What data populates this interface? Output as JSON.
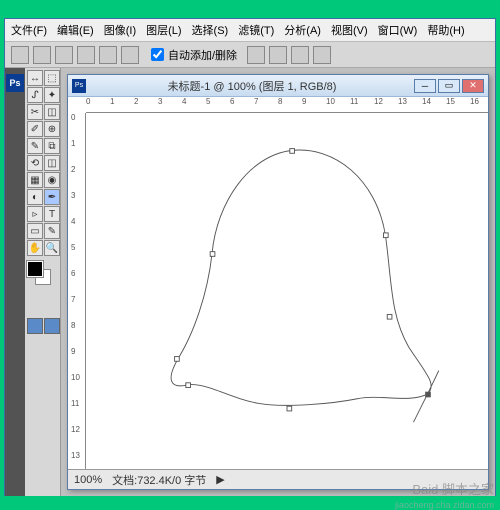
{
  "menubar": {
    "file": "文件(F)",
    "edit": "编辑(E)",
    "image": "图像(I)",
    "layer": "图层(L)",
    "select": "选择(S)",
    "filter": "滤镜(T)",
    "analysis": "分析(A)",
    "view": "视图(V)",
    "window": "窗口(W)",
    "help": "帮助(H)"
  },
  "toolbar": {
    "auto_add_delete": "自动添加/删除"
  },
  "app_badge": "Ps",
  "tools": {
    "move": "↔",
    "marquee": "⬚",
    "lasso": "ᔑ",
    "wand": "✦",
    "crop": "✂",
    "slice": "◫",
    "eyedrop": "✐",
    "heal": "⊕",
    "brush": "✎",
    "stamp": "⧉",
    "history": "⟲",
    "eraser": "◫",
    "gradient": "▦",
    "blur": "◉",
    "dodge": "◐",
    "pen": "✒",
    "type": "T",
    "path": "▹",
    "shape": "▭",
    "notes": "✎",
    "hand": "✋",
    "zoom": "🔍"
  },
  "doc": {
    "icon": "Ps",
    "title": "未标题-1 @ 100% (图层 1, RGB/8)",
    "ruler_h": [
      "0",
      "1",
      "2",
      "3",
      "4",
      "5",
      "6",
      "7",
      "8",
      "9",
      "10",
      "11",
      "12",
      "13",
      "14",
      "15",
      "16"
    ],
    "ruler_v": [
      "0",
      "1",
      "2",
      "3",
      "4",
      "5",
      "6",
      "7",
      "8",
      "9",
      "10",
      "11",
      "12",
      "13"
    ]
  },
  "status": {
    "zoom": "100%",
    "docinfo": "文档:732.4K/0 字节",
    "arrow": "▶"
  },
  "watermark": {
    "main": "Baid 脚本之家",
    "sub": "jiaocheng.cha zidan.com"
  }
}
